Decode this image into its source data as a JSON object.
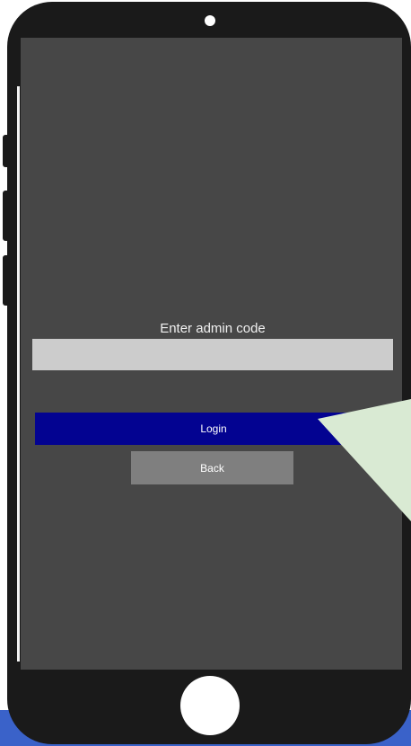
{
  "login_screen": {
    "prompt_label": "Enter admin code",
    "code_input_value": "",
    "code_input_placeholder": "",
    "login_button_label": "Login",
    "back_button_label": "Back"
  },
  "colors": {
    "screen_background": "#474747",
    "phone_frame": "#1a1a1a",
    "input_background": "#cccccc",
    "login_button": "#030391",
    "back_button": "#7f7f7f",
    "callout": "#d9ead3",
    "bottom_strip": "#3a62c9"
  },
  "icons": {
    "camera": "camera-dot-icon",
    "home": "home-button-icon"
  }
}
